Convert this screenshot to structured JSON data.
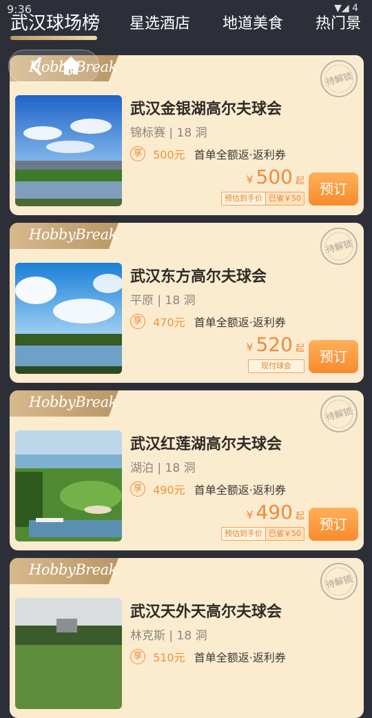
{
  "status": {
    "time": "9:36",
    "signal": "▼◢ 4"
  },
  "tabs": [
    {
      "label": "武汉球场榜",
      "active": true
    },
    {
      "label": "星选酒店",
      "active": false
    },
    {
      "label": "地道美食",
      "active": false
    },
    {
      "label": "热门景",
      "active": false
    }
  ],
  "brand": "HobbyBreak",
  "stamp_text": "待解锁",
  "book_label": "预订",
  "cards": [
    {
      "name": "武汉金银湖高尔夫球会",
      "meta": "锦标赛 | 18 洞",
      "promo_badge": "享",
      "promo_amount": "500元",
      "promo_desc": "首单全额返·返利券",
      "currency": "¥",
      "price": "500",
      "price_suffix": "起",
      "tags": [
        "预估到手价",
        "已省￥50"
      ]
    },
    {
      "name": "武汉东方高尔夫球会",
      "meta": "平原 | 18 洞",
      "promo_badge": "享",
      "promo_amount": "470元",
      "promo_desc": "首单全额返·返利券",
      "currency": "¥",
      "price": "520",
      "price_suffix": "起",
      "tags": [
        "现付球会"
      ]
    },
    {
      "name": "武汉红莲湖高尔夫球会",
      "meta": "湖泊 | 18 洞",
      "promo_badge": "享",
      "promo_amount": "490元",
      "promo_desc": "首单全额返·返利券",
      "currency": "¥",
      "price": "490",
      "price_suffix": "起",
      "tags": [
        "预估到手价",
        "已省￥50"
      ]
    },
    {
      "name": "武汉天外天高尔夫球会",
      "meta": "林克斯 | 18 洞",
      "promo_badge": "享",
      "promo_amount": "510元",
      "promo_desc": "首单全额返·返利券",
      "currency": "¥",
      "price": "",
      "price_suffix": "",
      "tags": []
    }
  ],
  "colors": {
    "accent": "#f08a3c",
    "card_bg": "#fbecd0",
    "page_bg": "#2d2f38",
    "ribbon": "#c9a97a"
  }
}
